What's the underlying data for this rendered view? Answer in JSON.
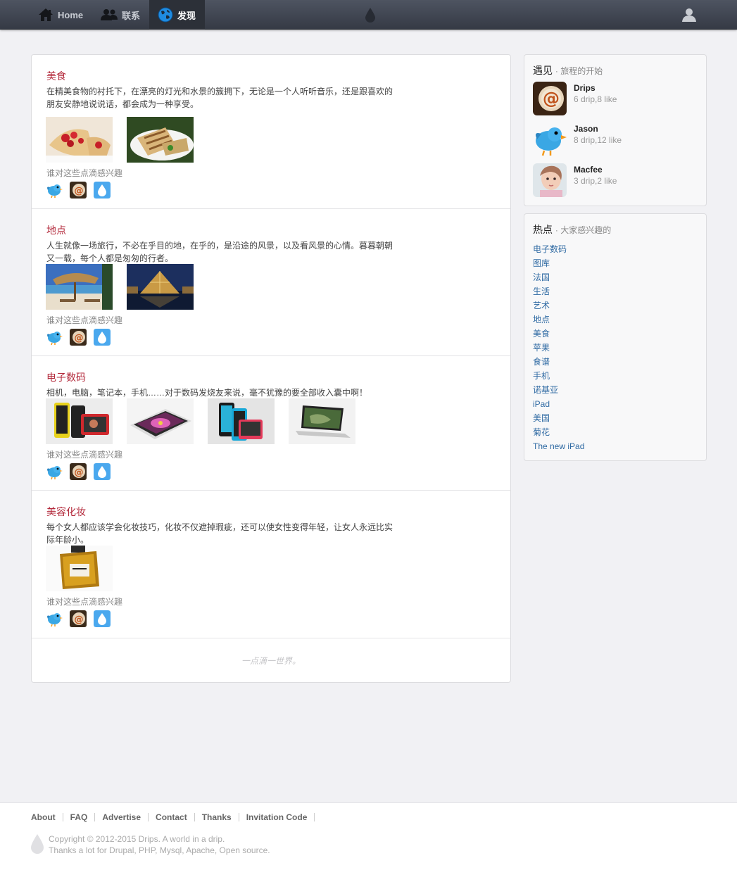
{
  "navbar": {
    "items": [
      {
        "label": "Home",
        "icon": "home-icon"
      },
      {
        "label": "联系",
        "icon": "contacts-icon"
      },
      {
        "label": "发现",
        "icon": "globe-icon",
        "active": true
      }
    ],
    "center_icon": "drop-icon",
    "user_icon": "user-icon"
  },
  "feed": {
    "interest_label": "谁对这些点滴感兴趣",
    "items": [
      {
        "title": "美食",
        "description": "在精美食物的衬托下，在漂亮的灯光和水景的簇拥下，无论是一个人听听音乐，还是跟喜欢的朋友安静地说说话，都会成为一种享受。",
        "images": [
          "wrap-strawberry-photo",
          "grilled-wrap-photo"
        ]
      },
      {
        "title": "地点",
        "description": "人生就像一场旅行，不必在乎目的地，在乎的，是沿途的风景，以及看风景的心情。暮暮朝朝又一载，每个人都是匆匆的行者。",
        "images": [
          "beach-hut-photo",
          "louvre-pyramid-photo"
        ]
      },
      {
        "title": "电子数码",
        "description": "相机，电脑，笔记本，手机……对于数码发烧友来说，毫不犹豫的要全部收入囊中啊！",
        "images": [
          "lumia-phones-photo",
          "tablet-flower-photo",
          "lumia-tablet-photo",
          "laptop-photo"
        ]
      },
      {
        "title": "美容化妆",
        "description": "每个女人都应该学会化妆技巧，化妆不仅遮掉瑕疵，还可以使女性变得年轻，让女人永远比实际年龄小。",
        "images": [
          "perfume-bottle-photo"
        ]
      }
    ],
    "footer_text": "一点滴一世界。"
  },
  "sidebar": {
    "meet": {
      "title": "遇见",
      "subtitle": "· 旅程的开始",
      "users": [
        {
          "name": "Drips",
          "meta": "6 drip,8 like"
        },
        {
          "name": "Jason",
          "meta": "8 drip,12 like"
        },
        {
          "name": "Macfee",
          "meta": "3 drip,2 like"
        }
      ]
    },
    "hot": {
      "title": "热点",
      "subtitle": "· 大家感兴趣的",
      "tags": [
        "电子数码",
        "图库",
        "法国",
        "生活",
        "艺术",
        "地点",
        "美食",
        "苹果",
        "食谱",
        "手机",
        "诺基亚",
        "iPad",
        "美国",
        "菊花",
        "The new iPad"
      ]
    }
  },
  "footer": {
    "links": [
      "About",
      "FAQ",
      "Advertise",
      "Contact",
      "Thanks",
      "Invitation Code"
    ],
    "copyright": "Copyright © 2012-2015 Drips. A world in a drip.",
    "thanks": "Thanks a lot for Drupal, PHP, Mysql, Apache, Open source."
  },
  "colors": {
    "nav_bg": "#3f4450",
    "title_red": "#b3293b",
    "link_blue": "#2f6aa3",
    "page_bg": "#f1f1f4"
  }
}
